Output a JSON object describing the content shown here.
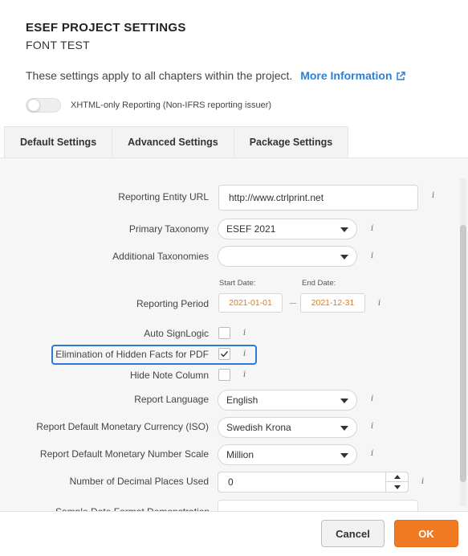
{
  "header": {
    "title": "ESEF PROJECT SETTINGS",
    "subtitle": "FONT TEST",
    "description": "These settings apply to all chapters within the project.",
    "more_link": "More Information",
    "link_icon": "external-link-icon",
    "accent_color": "#2f7fd3"
  },
  "toggle": {
    "label": "XHTML-only Reporting (Non-IFRS reporting issuer)",
    "checked": false
  },
  "tabs": [
    {
      "label": "Default Settings",
      "active": true
    },
    {
      "label": "Advanced Settings",
      "active": false
    },
    {
      "label": "Package Settings",
      "active": false
    }
  ],
  "form": {
    "entity_url": {
      "label": "Reporting Entity URL",
      "value": "http://www.ctrlprint.net"
    },
    "primary_taxonomy": {
      "label": "Primary Taxonomy",
      "value": "ESEF 2021"
    },
    "additional_taxonomies": {
      "label": "Additional Taxonomies",
      "value": ""
    },
    "reporting_period": {
      "label": "Reporting Period",
      "start_label": "Start Date:",
      "start_value": "2021-01-01",
      "end_label": "End Date:",
      "end_value": "2021-12-31",
      "date_color": "#e07b1a"
    },
    "auto_signlogic": {
      "label": "Auto SignLogic",
      "checked": false
    },
    "elimination_hidden": {
      "label": "Elimination of Hidden Facts for PDF",
      "checked": true
    },
    "hide_note_column": {
      "label": "Hide Note Column",
      "checked": false
    },
    "report_language": {
      "label": "Report Language",
      "value": "English"
    },
    "monetary_currency": {
      "label": "Report Default Monetary Currency (ISO)",
      "value": "Swedish Krona"
    },
    "number_scale": {
      "label": "Report Default Monetary Number Scale",
      "value": "Million"
    },
    "decimal_places": {
      "label": "Number of Decimal Places Used",
      "value": "0"
    },
    "partial_label": "Sample Date Format Demonstration",
    "info_glyph": "i"
  },
  "footer": {
    "cancel": "Cancel",
    "ok": "OK",
    "ok_color": "#f07a22"
  }
}
